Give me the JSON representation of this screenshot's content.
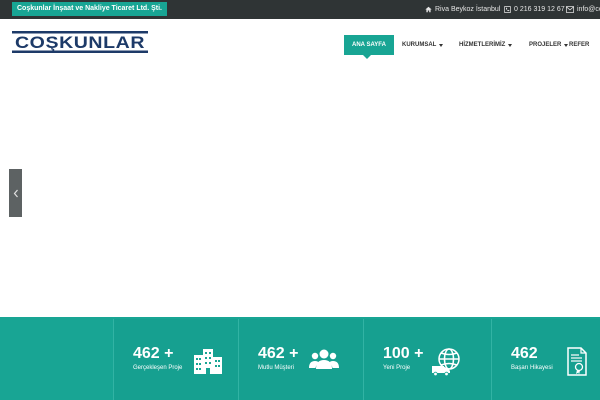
{
  "topbar": {
    "company": "Coşkunlar İnşaat ve Nakliye Ticaret Ltd. Şti.",
    "address": "Riva Beykoz İstanbul",
    "phone": "0 216 319 12 67",
    "email": "info@co"
  },
  "header": {
    "logo_text": "COŞKUNLAR",
    "nav": [
      {
        "label": "ANA SAYFA",
        "active": true
      },
      {
        "label": "KURUMSAL",
        "dropdown": true
      },
      {
        "label": "HİZMETLERİMİZ",
        "dropdown": true
      },
      {
        "label": "PROJELER",
        "dropdown": true
      },
      {
        "label": "REFER"
      }
    ]
  },
  "slider": {
    "prev_icon": "chevron-left-icon"
  },
  "stats": [
    {
      "value": "462 +",
      "label": "Gerçekleşen Proje",
      "icon": "buildings-icon"
    },
    {
      "value": "462 +",
      "label": "Mutlu Müşteri",
      "icon": "users-group-icon"
    },
    {
      "value": "100 +",
      "label": "Yeni Proje",
      "icon": "globe-truck-icon"
    },
    {
      "value": "462",
      "label": "Başarı Hikayesi",
      "icon": "certificate-icon"
    }
  ],
  "colors": {
    "accent": "#18a594",
    "topbar": "#2f3435",
    "logo": "#1d3a68"
  }
}
